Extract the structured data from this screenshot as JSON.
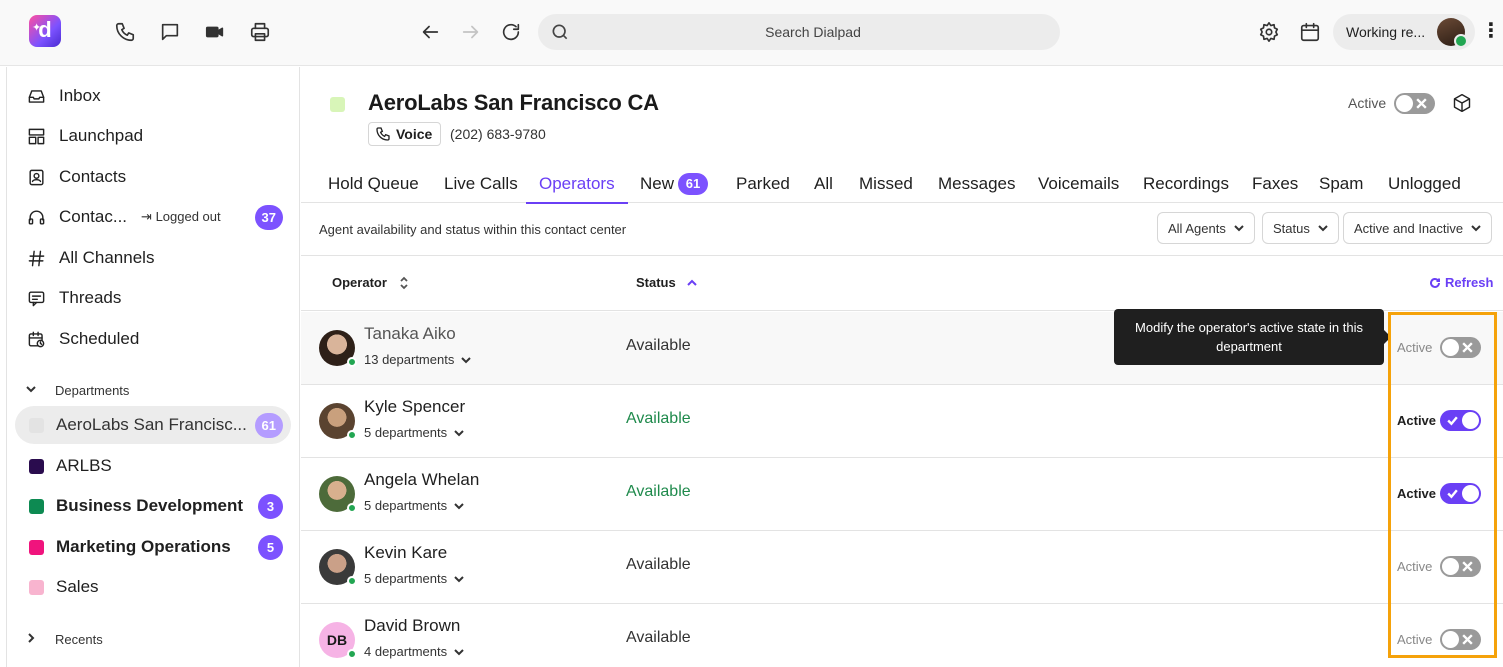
{
  "topbar": {
    "search_placeholder": "Search Dialpad",
    "status_label": "Working re...",
    "icons": [
      "phone-icon",
      "message-icon",
      "video-icon",
      "printer-icon",
      "back-icon",
      "forward-icon",
      "reload-icon",
      "settings-icon",
      "calendar-icon",
      "more-icon"
    ]
  },
  "sidebar": {
    "items": [
      {
        "label": "Inbox",
        "icon": "inbox-icon"
      },
      {
        "label": "Launchpad",
        "icon": "launchpad-icon"
      },
      {
        "label": "Contacts",
        "icon": "contacts-icon"
      },
      {
        "label": "Contac...",
        "icon": "headset-icon",
        "sub": "Logged out",
        "badge": "37"
      },
      {
        "label": "All Channels",
        "icon": "hash-icon"
      },
      {
        "label": "Threads",
        "icon": "threads-icon"
      },
      {
        "label": "Scheduled",
        "icon": "scheduled-icon"
      }
    ],
    "departments_header": "Departments",
    "departments": [
      {
        "label": "AeroLabs San Francisc...",
        "badge": "61",
        "color": "#e3e3e3"
      },
      {
        "label": "ARLBS",
        "color": "#2a0c4e"
      },
      {
        "label": "Business Development",
        "badge": "3",
        "color": "#0d8a52"
      },
      {
        "label": "Marketing Operations",
        "badge": "5",
        "color": "#f0147d"
      },
      {
        "label": "Sales",
        "color": "#f8b4cf"
      }
    ],
    "recents_header": "Recents"
  },
  "header": {
    "title": "AeroLabs San Francisco CA",
    "channel": "Voice",
    "phone": "(202) 683-9780",
    "active_label": "Active",
    "active_on": false,
    "dept_color": "#d8f5b8"
  },
  "tabs": [
    {
      "label": "Hold Queue"
    },
    {
      "label": "Live Calls"
    },
    {
      "label": "Operators",
      "active": true
    },
    {
      "label": "New",
      "badge": "61"
    },
    {
      "label": "Parked"
    },
    {
      "label": "All"
    },
    {
      "label": "Missed"
    },
    {
      "label": "Messages"
    },
    {
      "label": "Voicemails"
    },
    {
      "label": "Recordings"
    },
    {
      "label": "Faxes"
    },
    {
      "label": "Spam"
    },
    {
      "label": "Unlogged"
    }
  ],
  "subbar": {
    "description": "Agent availability and status within this contact center",
    "filters": [
      "All Agents",
      "Status",
      "Active and Inactive"
    ]
  },
  "table": {
    "col_operator": "Operator",
    "col_status": "Status",
    "refresh": "Refresh",
    "rows": [
      {
        "name": "Tanaka Aiko",
        "departments": "13 departments",
        "status": "Available",
        "active_label": "Active",
        "active": false
      },
      {
        "name": "Kyle Spencer",
        "departments": "5 departments",
        "status": "Available",
        "active_label": "Active",
        "active": true
      },
      {
        "name": "Angela Whelan",
        "departments": "5 departments",
        "status": "Available",
        "active_label": "Active",
        "active": true
      },
      {
        "name": "Kevin Kare",
        "departments": "5 departments",
        "status": "Available",
        "active_label": "Active",
        "active": false
      },
      {
        "name": "David Brown",
        "initials": "DB",
        "departments": "4 departments",
        "status": "Available",
        "active_label": "Active",
        "active": false
      }
    ]
  },
  "tooltip": "Modify the operator's active state in this department",
  "colors": {
    "accent": "#6a3ff5",
    "badge": "#7c52ff",
    "available_green": "#1f8a4c",
    "highlight": "#f5a20a"
  }
}
